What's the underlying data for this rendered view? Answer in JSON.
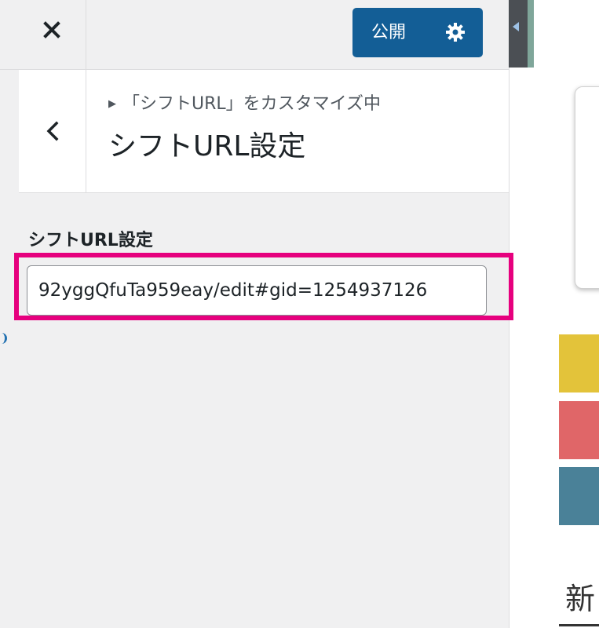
{
  "toolbar": {
    "close_icon": "close-icon",
    "publish_label": "公開",
    "settings_icon": "gear-icon"
  },
  "header": {
    "back_icon": "chevron-left-icon",
    "breadcrumb": "「シフトURL」をカスタマイズ中",
    "title": "シフトURL設定"
  },
  "field": {
    "label": "シフトURL設定",
    "value": "92yggQfuTa959eay/edit#gid=1254937126"
  },
  "preview": {
    "text": "新"
  },
  "colors": {
    "publish": "#135e96",
    "highlight": "#e6007e",
    "yellow": "#e3c33a",
    "red": "#e06668",
    "teal": "#4a8198"
  }
}
